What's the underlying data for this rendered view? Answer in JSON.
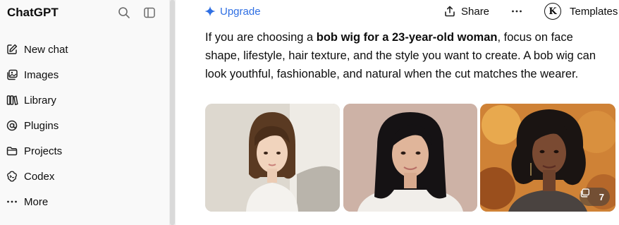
{
  "sidebar": {
    "brand": "ChatGPT",
    "items": [
      {
        "label": "New chat",
        "icon": "edit-icon"
      },
      {
        "label": "Images",
        "icon": "images-icon"
      },
      {
        "label": "Library",
        "icon": "library-icon"
      },
      {
        "label": "Plugins",
        "icon": "plugins-icon"
      },
      {
        "label": "Projects",
        "icon": "folder-icon"
      },
      {
        "label": "Codex",
        "icon": "codex-icon"
      },
      {
        "label": "More",
        "icon": "more-icon"
      }
    ]
  },
  "header": {
    "upgrade_label": "Upgrade",
    "share_label": "Share",
    "templates_label": "Templates",
    "templates_logo_letter": "K",
    "accent_color": "#2f6fe3"
  },
  "message": {
    "prefix": "If you are choosing a ",
    "bold": "bob wig for a 23-year-old woman",
    "suffix": ", focus on face shape, lifestyle, hair texture, and the style you want to create. A bob wig can look youthful, fashionable, and natural when the cut matches the wearer."
  },
  "images": {
    "more_count": "7"
  }
}
